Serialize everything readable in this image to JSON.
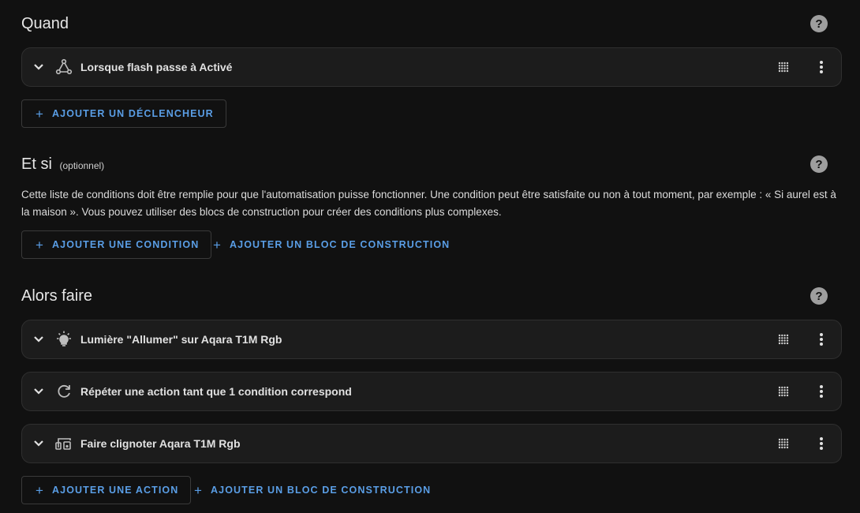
{
  "quand": {
    "title": "Quand",
    "triggers": [
      {
        "label": "Lorsque flash passe à Activé",
        "icon": "trigger-graph-icon"
      }
    ],
    "add_trigger": "AJOUTER UN DÉCLENCHEUR"
  },
  "etsi": {
    "title": "Et si",
    "optional": "(optionnel)",
    "description": "Cette liste de conditions doit être remplie pour que l'automatisation puisse fonctionner. Une condition peut être satisfaite ou non à tout moment, par exemple : « Si aurel est à la maison ». Vous pouvez utiliser des blocs de construction pour créer des conditions plus complexes.",
    "add_condition": "AJOUTER UNE CONDITION",
    "add_block": "AJOUTER UN BLOC DE CONSTRUCTION"
  },
  "alors": {
    "title": "Alors faire",
    "actions": [
      {
        "label": "Lumière \"Allumer\" sur Aqara T1M Rgb",
        "icon": "lightbulb-icon"
      },
      {
        "label": "Répéter une action tant que 1 condition correspond",
        "icon": "refresh-icon"
      },
      {
        "label": "Faire clignoter Aqara T1M Rgb",
        "icon": "devices-icon"
      }
    ],
    "add_action": "AJOUTER UNE ACTION",
    "add_block": "AJOUTER UN BLOC DE CONSTRUCTION"
  },
  "colors": {
    "background": "#111111",
    "card": "#1c1c1c",
    "accent": "#5a9ee6",
    "help_icon": "#9e9e9e"
  }
}
